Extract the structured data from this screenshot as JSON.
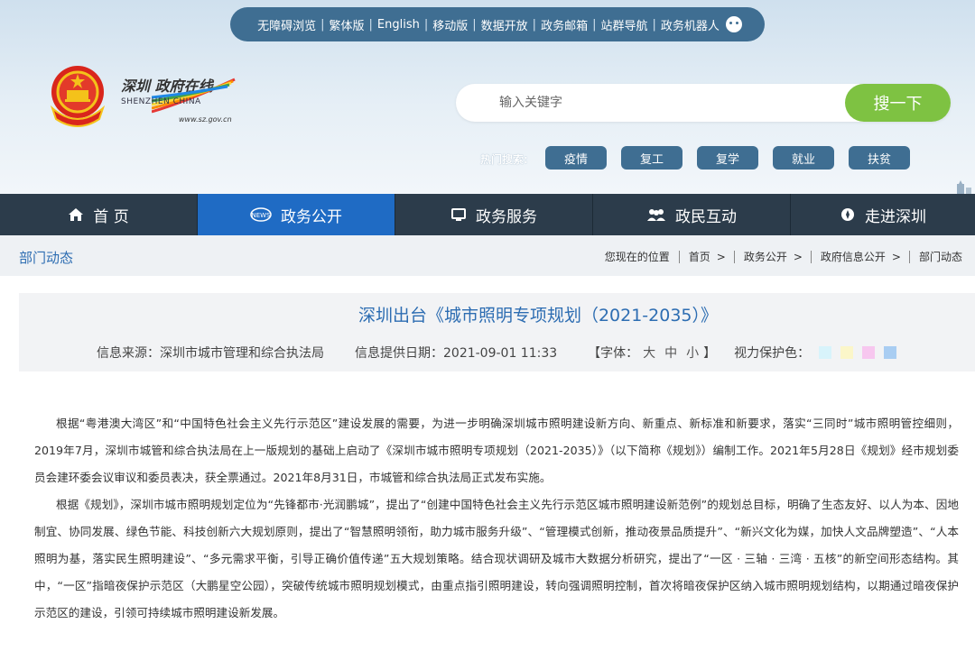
{
  "top_links": [
    "无障碍浏览",
    "繁体版",
    "English",
    "移动版",
    "数据开放",
    "政务邮箱",
    "站群导航",
    "政务机器人"
  ],
  "logo": {
    "cn": "深圳 政府在线",
    "en": "SHENZHEN CHINA",
    "url": "www.sz.gov.cn"
  },
  "search": {
    "placeholder": "输入关键字",
    "button": "搜一下"
  },
  "hot": {
    "label": "热门搜索:",
    "tags": [
      "疫情",
      "复工",
      "复学",
      "就业",
      "扶贫"
    ]
  },
  "nav": [
    {
      "label": "首 页",
      "icon": "home-icon"
    },
    {
      "label": "政务公开",
      "icon": "news-icon"
    },
    {
      "label": "政务服务",
      "icon": "monitor-icon"
    },
    {
      "label": "政民互动",
      "icon": "people-icon"
    },
    {
      "label": "走进深圳",
      "icon": "compass-icon"
    }
  ],
  "breadcrumb": {
    "section": "部门动态",
    "location_label": "您现在的位置",
    "items": [
      "首页",
      "政务公开",
      "政府信息公开",
      "部门动态"
    ]
  },
  "article": {
    "title": "深圳出台《城市照明专项规划（2021-2035）》",
    "source": "信息来源：深圳市城市管理和综合执法局",
    "date": "信息提供日期：2021-09-01 11:33",
    "font_label": "【字体：",
    "font_sizes": [
      "大",
      "中",
      "小"
    ],
    "font_close": "】",
    "eye_label": "视力保护色：",
    "eye_colors": [
      "#d8f3fb",
      "#fbf6c9",
      "#f7c7ef",
      "#a9cdf2"
    ],
    "paragraphs": [
      "根据“粤港澳大湾区”和“中国特色社会主义先行示范区”建设发展的需要，为进一步明确深圳城市照明建设新方向、新重点、新标准和新要求，落实“三同时”城市照明管控细则， 2019年7月，深圳市城管和综合执法局在上一版规划的基础上启动了《深圳市城市照明专项规划（2021-2035）》（以下简称《规划》）编制工作。2021年5月28日《规划》经市规划委员会建环委会议审议和委员表决，获全票通过。2021年8月31日，市城管和综合执法局正式发布实施。",
      "根据《规划》，深圳市城市照明规划定位为“先锋都市·光润鹏城”，提出了“创建中国特色社会主义先行示范区城市照明建设新范例”的规划总目标，明确了生态友好、以人为本、因地制宜、协同发展、绿色节能、科技创新六大规划原则，提出了“智慧照明领衔，助力城市服务升级”、“管理模式创新，推动夜景品质提升”、“新兴文化为媒，加快人文品牌塑造”、“人本照明为基，落实民生照明建设”、“多元需求平衡，引导正确价值传递”五大规划策略。结合现状调研及城市大数据分析研究，提出了“一区 · 三轴 · 三湾 · 五核”的新空间形态结构。其中，“一区”指暗夜保护示范区（大鹏星空公园），突破传统城市照明规划模式，由重点指引照明建设，转向强调照明控制，首次将暗夜保护区纳入城市照明规划结构，以期通过暗夜保护示范区的建设，引领可持续城市照明建设新发展。"
    ]
  }
}
